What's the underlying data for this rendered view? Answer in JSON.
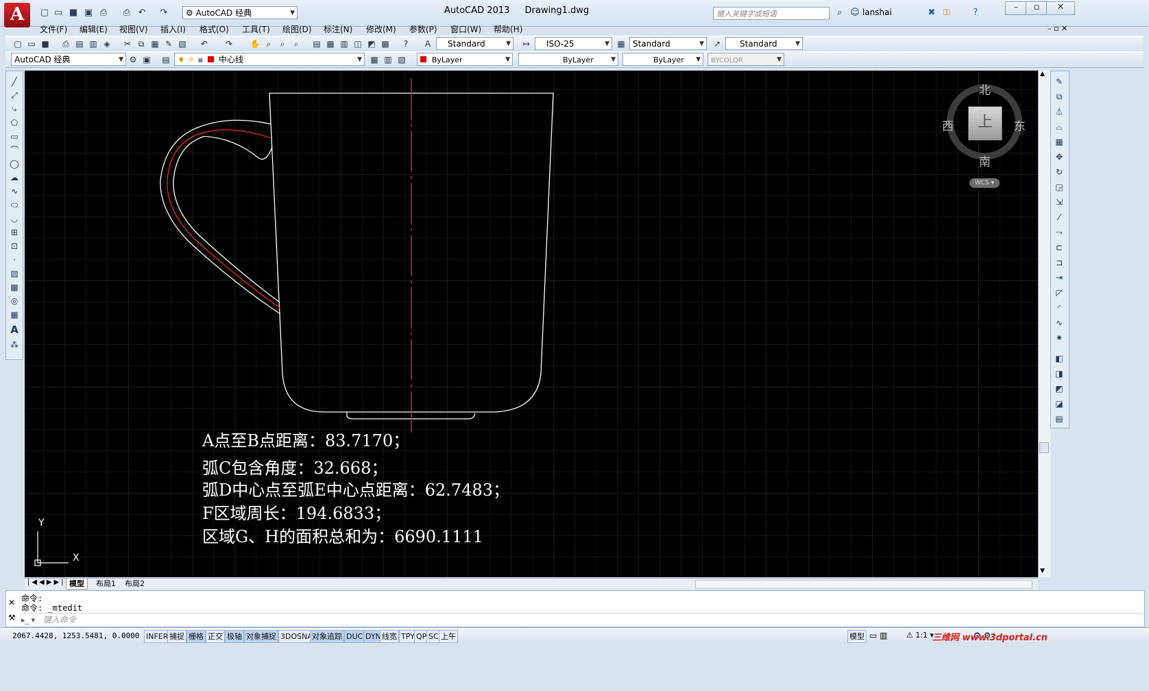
{
  "title": {
    "app": "AutoCAD 2013",
    "file": "Drawing1.dwg"
  },
  "workspace": "AutoCAD 经典",
  "search": {
    "placeholder": "键入关键字或短语"
  },
  "user": "lanshai",
  "menus": [
    "文件(F)",
    "编辑(E)",
    "视图(V)",
    "插入(I)",
    "格式(O)",
    "工具(T)",
    "绘图(D)",
    "标注(N)",
    "修改(M)",
    "参数(P)",
    "窗口(W)",
    "帮助(H)"
  ],
  "styles": {
    "text_style": "Standard",
    "dim_style": "ISO-25",
    "table_style": "Standard",
    "mleader_style": "Standard"
  },
  "layers": {
    "workspace": "AutoCAD 经典",
    "current_layer": "中心线",
    "color": "ByLayer",
    "linetype": "ByLayer",
    "lineweight": "ByLayer",
    "plotstyle": "BYCOLOR"
  },
  "viewcube": {
    "north": "北",
    "south": "南",
    "east": "东",
    "west": "西",
    "face": "上",
    "wcs": "WCS"
  },
  "ucs": {
    "x": "X",
    "y": "Y"
  },
  "annotations": [
    "A点至B点距离：83.7170；",
    "弧C包含角度：32.668；",
    "弧D中心点至弧E中心点距离：62.7483；",
    "F区域周长：194.6833；",
    "区域G、H的面积总和为：6690.1111"
  ],
  "tabs": [
    "模型",
    "布局1",
    "布局2"
  ],
  "command": {
    "history": [
      "命令:",
      "命令: _mtedit"
    ],
    "prompt": "键入命令"
  },
  "status": {
    "coords": "2067.4428, 1253.5481, 0.0000",
    "toggles": [
      "INFER",
      "捕捉",
      "栅格",
      "正交",
      "极轴",
      "对象捕捉",
      "3DOSNAP",
      "对象追踪",
      "DUCS",
      "DYN",
      "线宽",
      "TPY",
      "QP",
      "SC",
      "上午"
    ],
    "model": "模型",
    "scale": "1:1"
  },
  "watermark": "三维网 www.3dportal.cn",
  "colors": {
    "canvas": "#000000",
    "centerline": "#ff2a2a",
    "line": "#ffffff",
    "grid": "#2a2a2a"
  }
}
